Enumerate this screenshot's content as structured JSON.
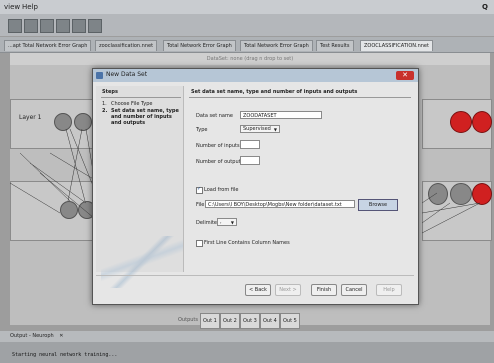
{
  "menubar": {
    "items": [
      "view",
      "Help"
    ]
  },
  "tabs": [
    {
      "label": "...apt  Total Network Error Graph",
      "active": false
    },
    {
      "label": "zooclassification.nnet",
      "active": false
    },
    {
      "label": "Total Network Error Graph",
      "active": false
    },
    {
      "label": "Total Network Error Graph",
      "active": false
    },
    {
      "label": "Test Results",
      "active": false
    },
    {
      "label": "ZOOCLASSIFICATION.nnet",
      "active": true
    }
  ],
  "editor": {
    "dataset_strip": "DataSet: none (drag n drop to set)",
    "layer_label": "Layer 1",
    "outputs_label": "Outputs",
    "outputs": [
      "Out 1",
      "Out 2",
      "Out 3",
      "Out 4",
      "Out 5"
    ]
  },
  "dialog": {
    "title": "New Data Set",
    "close_icon": "close-icon",
    "steps": {
      "title": "Steps",
      "items": [
        {
          "num": "1.",
          "text": "Choose File Type"
        },
        {
          "num": "2.",
          "text": "Set data set name, type and number of inputs and outputs"
        }
      ]
    },
    "content_title": "Set data set name, type and number of inputs and outputs",
    "fields": {
      "name_label": "Data set name",
      "name_value": "ZOODATASET",
      "type_label": "Type",
      "type_value": "Supervised",
      "inputs_label": "Number of inputs",
      "inputs_value": "",
      "outputs_label": "Number of outputs",
      "outputs_value": "",
      "load_from_file_label": "Load from file",
      "load_from_file_checked": true,
      "file_label": "File:",
      "file_value": "C:\\Users\\I BOY\\Desktop\\Mogbs\\New folder\\dataset.txt",
      "browse_label": "Browse",
      "delimiter_label": "Delimiter",
      "delimiter_value": ",",
      "first_line_label": "First Line Contains Column Names",
      "first_line_checked": false
    },
    "buttons": {
      "back": "< Back",
      "next": "Next >",
      "finish": "Finish",
      "cancel": "Cancel",
      "help": "Help"
    }
  },
  "output_panel": {
    "header": "Output - Neuroph",
    "console_line": "Starting neural network training..."
  }
}
